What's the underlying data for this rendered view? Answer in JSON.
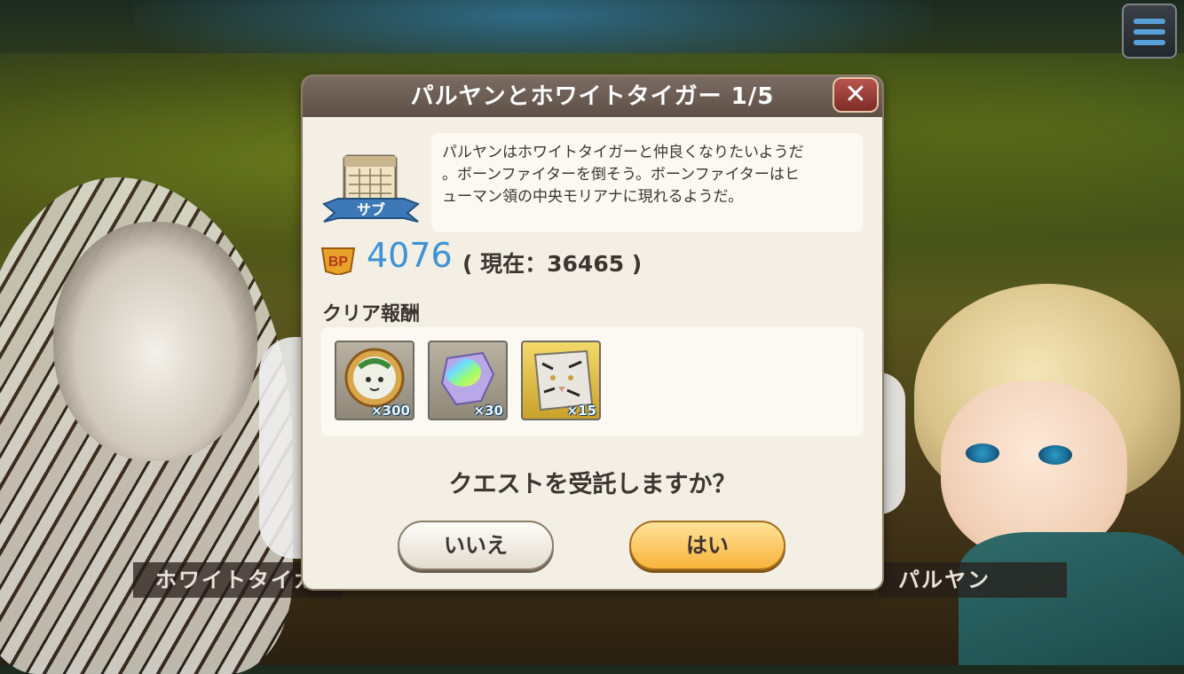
{
  "background": {
    "left_character_name": "ホワイトタイガ",
    "right_character_name": "パルヤン"
  },
  "menu": {
    "icon": "hamburger-menu-icon"
  },
  "dialog": {
    "title": "パルヤンとホワイトタイガー 1/5",
    "close_label": "✕",
    "quest_type_label": "サブ",
    "description": "パルヤンはホワイトタイガーと仲良くなりたいようだ\n。ボーンファイターを倒そう。ボーンファイターはヒ\nューマン領の中央モリアナに現れるようだ。",
    "bp_label": "BP",
    "bp_value": "4076",
    "bp_current": "( 現在：36465 )",
    "rewards_label": "クリア報酬",
    "rewards": [
      {
        "name": "white-tiger-medal",
        "qty": "×300"
      },
      {
        "name": "rainbow-crystal",
        "qty": "×30"
      },
      {
        "name": "white-tiger-portrait",
        "qty": "×15"
      }
    ],
    "confirm_text": "クエストを受託しますか？",
    "no_label": "いいえ",
    "yes_label": "はい"
  },
  "colors": {
    "bp_value": "#3b93d6",
    "yes_button": "#f7b43b",
    "header": "#6b5d54",
    "close_button": "#9e3f3a"
  }
}
